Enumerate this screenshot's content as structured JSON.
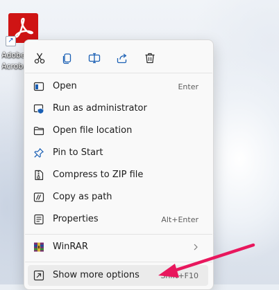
{
  "desktop": {
    "icon_label": "Adobe\nAcrobat"
  },
  "quick_actions": [
    {
      "name": "cut-icon"
    },
    {
      "name": "copy-icon"
    },
    {
      "name": "rename-icon"
    },
    {
      "name": "share-icon"
    },
    {
      "name": "delete-icon"
    }
  ],
  "menu": {
    "open": {
      "label": "Open",
      "shortcut": "Enter",
      "icon": "open-icon"
    },
    "run_admin": {
      "label": "Run as administrator",
      "icon": "shield-icon"
    },
    "open_location": {
      "label": "Open file location",
      "icon": "folder-icon"
    },
    "pin_start": {
      "label": "Pin to Start",
      "icon": "pin-icon"
    },
    "compress_zip": {
      "label": "Compress to ZIP file",
      "icon": "zip-icon"
    },
    "copy_path": {
      "label": "Copy as path",
      "icon": "copy-path-icon"
    },
    "properties": {
      "label": "Properties",
      "shortcut": "Alt+Enter",
      "icon": "properties-icon"
    },
    "winrar": {
      "label": "WinRAR",
      "icon": "winrar-icon"
    },
    "more_options": {
      "label": "Show more options",
      "shortcut": "Shift+F10",
      "icon": "more-options-icon"
    }
  },
  "annotation": {
    "color": "#e8175d"
  },
  "colors": {
    "accent": "#1a5fb4",
    "brand_red": "#cf1414"
  }
}
